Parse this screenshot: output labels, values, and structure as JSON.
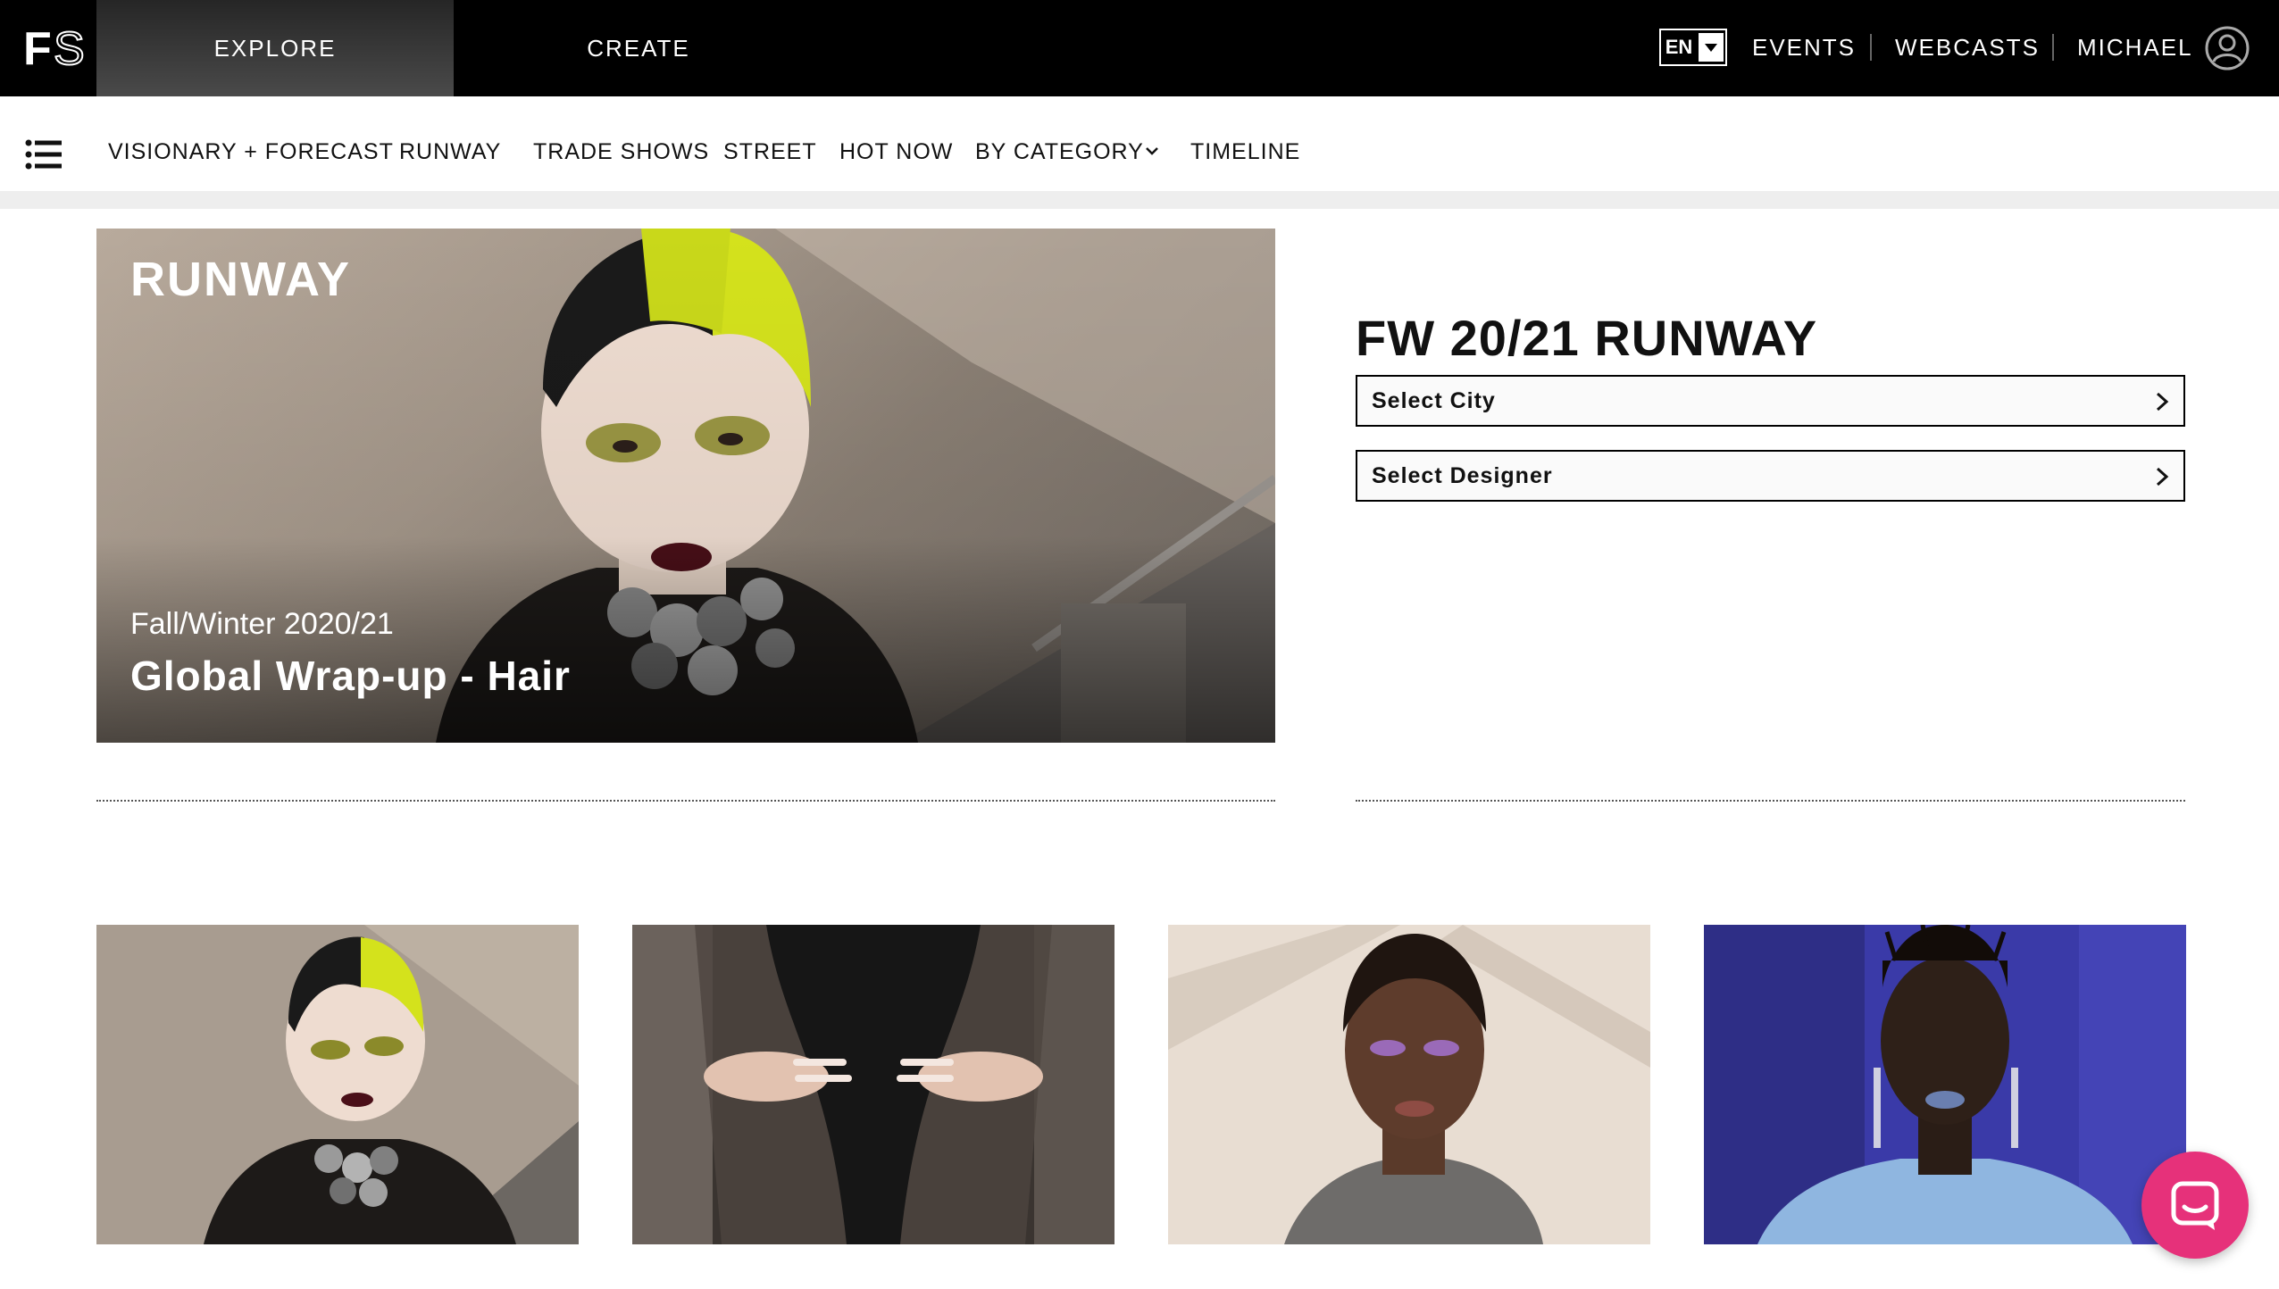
{
  "brand": {
    "logo_text": "FS"
  },
  "topbar": {
    "tabs": [
      {
        "label": "EXPLORE",
        "active": true
      },
      {
        "label": "CREATE",
        "active": false
      }
    ],
    "language": "EN",
    "links": [
      "EVENTS",
      "WEBCASTS",
      "MICHAEL"
    ],
    "user_icon": "user-circle-icon"
  },
  "subnav": {
    "menu_icon": "list-menu-icon",
    "items": [
      "VISIONARY + FORECAST",
      "RUNWAY",
      "TRADE SHOWS",
      "STREET",
      "HOT NOW",
      "BY CATEGORY",
      "TIMELINE"
    ],
    "dropdown_icon": "chevron-down-icon"
  },
  "hero": {
    "section_label": "RUNWAY",
    "season": "Fall/Winter 2020/21",
    "title": "Global Wrap-up - Hair"
  },
  "panel": {
    "title": "FW 20/21 RUNWAY",
    "selects": [
      {
        "label": "Select City",
        "icon": "chevron-right-icon"
      },
      {
        "label": "Select Designer",
        "icon": "chevron-right-icon"
      }
    ]
  },
  "thumbnails": [
    {
      "subject": "model-neon-yellow-hair"
    },
    {
      "subject": "hands-on-hips-sheer-dress"
    },
    {
      "subject": "model-purple-eyeshadow"
    },
    {
      "subject": "model-braids-blue-jacket"
    }
  ],
  "chat": {
    "icon": "chat-bubble-icon"
  },
  "colors": {
    "topbar_bg": "#000000",
    "accent_chat": "#e6317a",
    "neon_hair": "#d4e21c"
  }
}
